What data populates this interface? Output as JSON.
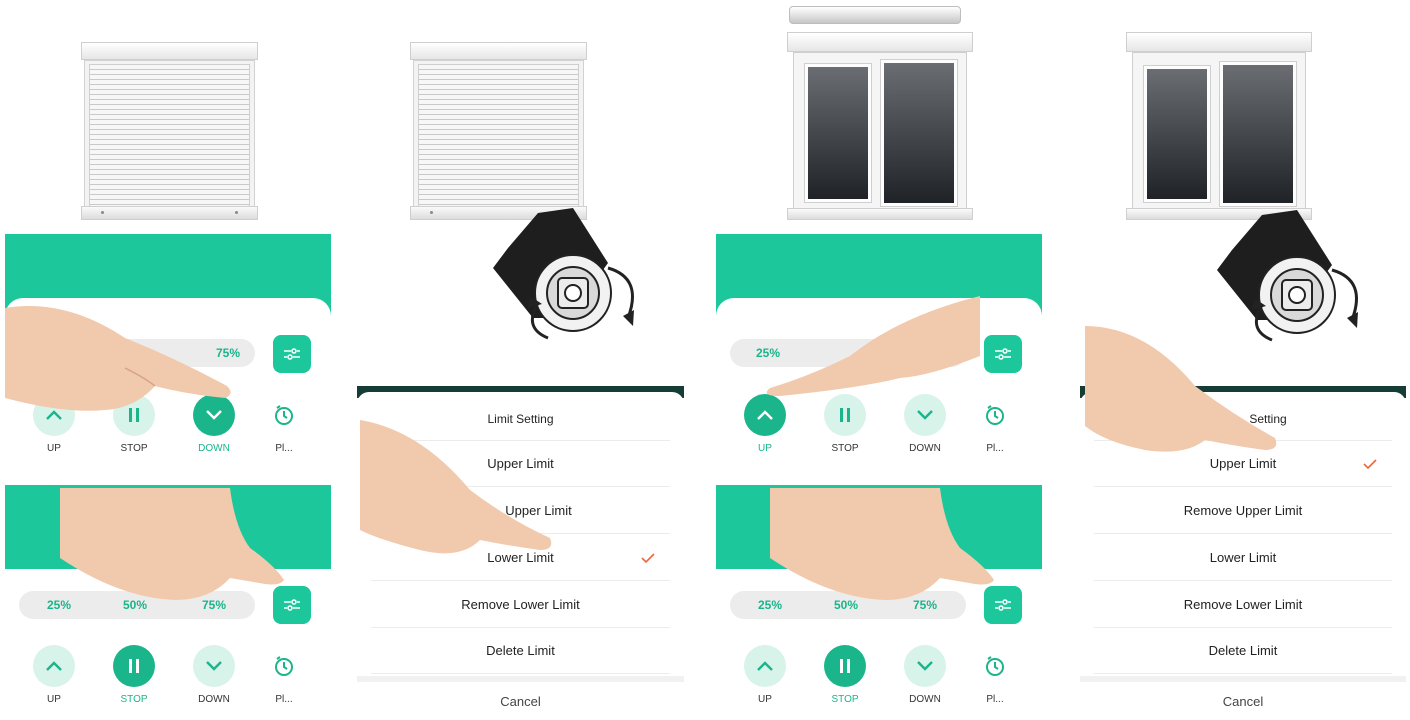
{
  "colors": {
    "accent": "#1cc79b",
    "accent_dark": "#1bb58b",
    "accent_light": "#d7f3ea",
    "dialog_band": "#163d35",
    "check": "#e8693c"
  },
  "panels": {
    "p1": {
      "positions": [
        "75%"
      ],
      "controls": {
        "up": "UP",
        "stop": "STOP",
        "down": "DOWN",
        "plan": "Pl..."
      },
      "active": "down"
    },
    "p2": {
      "positions": [
        "25%",
        "50%",
        "75%"
      ],
      "controls": {
        "up": "UP",
        "stop": "STOP",
        "down": "DOWN",
        "plan": "Pl..."
      },
      "active": "stop"
    },
    "p3": {
      "positions": [
        "25%"
      ],
      "controls": {
        "up": "UP",
        "stop": "STOP",
        "down": "DOWN",
        "plan": "Pl..."
      },
      "active": "up"
    },
    "p4": {
      "positions": [
        "25%",
        "50%",
        "75%"
      ],
      "controls": {
        "up": "UP",
        "stop": "STOP",
        "down": "DOWN",
        "plan": "Pl..."
      },
      "active": "stop"
    }
  },
  "dialog_left": {
    "title": "Limit Setting",
    "options": [
      "Upper Limit",
      "Upper Limit",
      "Lower Limit",
      "Remove Lower Limit",
      "Delete Limit"
    ],
    "checked": "Lower Limit",
    "cancel": "Cancel"
  },
  "dialog_right": {
    "title": "Setting",
    "options": [
      "Upper Limit",
      "Remove Upper Limit",
      "Lower Limit",
      "Remove Lower Limit",
      "Delete Limit"
    ],
    "checked": "Upper Limit",
    "cancel": "Cancel"
  },
  "icons": {
    "up": "chevron-up-icon",
    "stop": "pause-icon",
    "down": "chevron-down-icon",
    "plan": "clock-icon",
    "settings": "sliders-icon",
    "check": "check-icon"
  }
}
